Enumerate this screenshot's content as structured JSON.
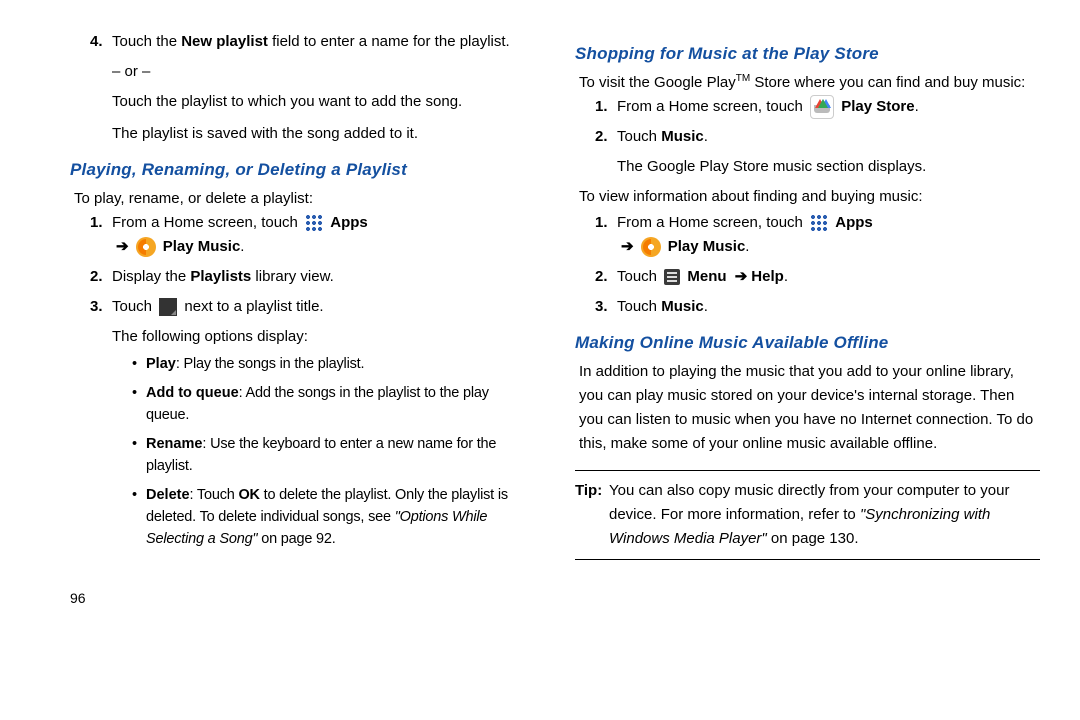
{
  "left": {
    "step4": {
      "num": "4.",
      "line1a": "Touch the ",
      "line1b": "New playlist",
      "line1c": " field to enter a name for the playlist.",
      "or": "– or –",
      "line2": "Touch the playlist to which you want to add the song.",
      "line3": "The playlist is saved with the song added to it."
    },
    "subhead1": "Playing, Renaming, or Deleting a Playlist",
    "intro1": "To play, rename, or delete a playlist:",
    "s1": {
      "num": "1.",
      "a": "From a Home screen, touch ",
      "apps": "Apps",
      "pm": "Play Music",
      "dot": "."
    },
    "s2": {
      "num": "2.",
      "a": "Display the ",
      "b": "Playlists",
      "c": " library view."
    },
    "s3": {
      "num": "3.",
      "a": "Touch ",
      "b": " next to a playlist title.",
      "c": "The following options display:"
    },
    "opts": {
      "play": {
        "t": "Play",
        "d": ": Play the songs in the playlist."
      },
      "add": {
        "t": "Add to queue",
        "d": ": Add the songs in the playlist to the play queue."
      },
      "ren": {
        "t": "Rename",
        "d": ": Use the keyboard to enter a new name for the playlist."
      },
      "del": {
        "t": "Delete",
        "d1": ": Touch ",
        "ok": "OK",
        "d2": " to delete the playlist. Only the playlist is deleted. To delete individual songs, see ",
        "ref": "\"Options While Selecting a Song\"",
        "d3": " on page 92."
      }
    },
    "pagenum": "96"
  },
  "right": {
    "subhead1": "Shopping for Music at the Play Store",
    "intro1a": "To visit the Google Play",
    "tm": "TM",
    "intro1b": " Store where you can find and buy music:",
    "r1": {
      "num": "1.",
      "a": "From a Home screen, touch ",
      "ps": "Play Store",
      "dot": "."
    },
    "r2": {
      "num": "2.",
      "a": "Touch ",
      "m": "Music",
      "dot": ".",
      "b": "The Google Play Store music section displays."
    },
    "intro2": "To view information about finding and buying music:",
    "q1": {
      "num": "1.",
      "a": "From a Home screen, touch ",
      "apps": "Apps",
      "pm": "Play Music",
      "dot": "."
    },
    "q2": {
      "num": "2.",
      "a": "Touch ",
      "menu": "Menu",
      "help": "Help",
      "dot": "."
    },
    "q3": {
      "num": "3.",
      "a": "Touch ",
      "m": "Music",
      "dot": "."
    },
    "subhead2": "Making Online Music Available Offline",
    "para": "In addition to playing the music that you add to your online library, you can play music stored on your device's internal storage. Then you can listen to music when you have no Internet connection. To do this, make some of your online music available offline.",
    "tip": {
      "label": "Tip:",
      "a": "You can also copy music directly from your computer to your device. For more information, refer to ",
      "ref": "\"Synchronizing with Windows Media Player\"",
      "b": "  on page 130."
    }
  },
  "arrow": "➔"
}
